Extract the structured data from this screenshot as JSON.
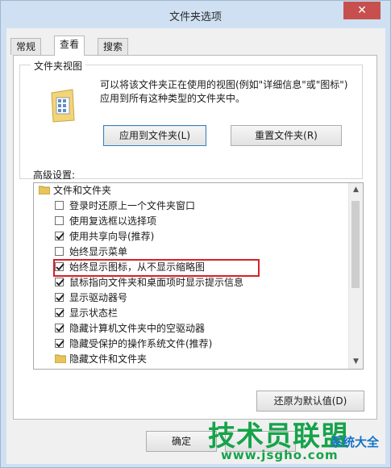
{
  "window": {
    "title": "文件夹选项",
    "close_glyph": "✕"
  },
  "tabs": [
    {
      "label": "常规",
      "active": false
    },
    {
      "label": "查看",
      "active": true
    },
    {
      "label": "搜索",
      "active": false
    }
  ],
  "folder_view": {
    "group_title": "文件夹视图",
    "description": "可以将该文件夹正在使用的视图(例如\"详细信息\"或\"图标\")应用到所有这种类型的文件夹中。",
    "apply_button": "应用到文件夹(L)",
    "reset_button": "重置文件夹(R)"
  },
  "advanced": {
    "label": "高级设置:",
    "items": [
      {
        "label": "文件和文件夹",
        "kind": "folder"
      },
      {
        "label": "登录时还原上一个文件夹窗口",
        "kind": "checkbox",
        "checked": false
      },
      {
        "label": "使用复选框以选择项",
        "kind": "checkbox",
        "checked": false
      },
      {
        "label": "使用共享向导(推荐)",
        "kind": "checkbox",
        "checked": true
      },
      {
        "label": "始终显示菜单",
        "kind": "checkbox",
        "checked": false
      },
      {
        "label": "始终显示图标，从不显示缩略图",
        "kind": "checkbox",
        "checked": true,
        "highlighted": true
      },
      {
        "label": "鼠标指向文件夹和桌面项时显示提示信息",
        "kind": "checkbox",
        "checked": true
      },
      {
        "label": "显示驱动器号",
        "kind": "checkbox",
        "checked": true
      },
      {
        "label": "显示状态栏",
        "kind": "checkbox",
        "checked": true
      },
      {
        "label": "隐藏计算机文件夹中的空驱动器",
        "kind": "checkbox",
        "checked": true
      },
      {
        "label": "隐藏受保护的操作系统文件(推荐)",
        "kind": "checkbox",
        "checked": true
      },
      {
        "label": "隐藏文件和文件夹",
        "kind": "folder"
      }
    ],
    "restore_button": "还原为默认值(D)"
  },
  "footer": {
    "ok_button": "确定"
  },
  "watermark": {
    "brand": "技术员联盟",
    "url": "www.jsgho.com",
    "side": "系统大全"
  },
  "colors": {
    "highlight": "#d72028",
    "close": "#c7504e",
    "watermark": "#16a34a"
  }
}
